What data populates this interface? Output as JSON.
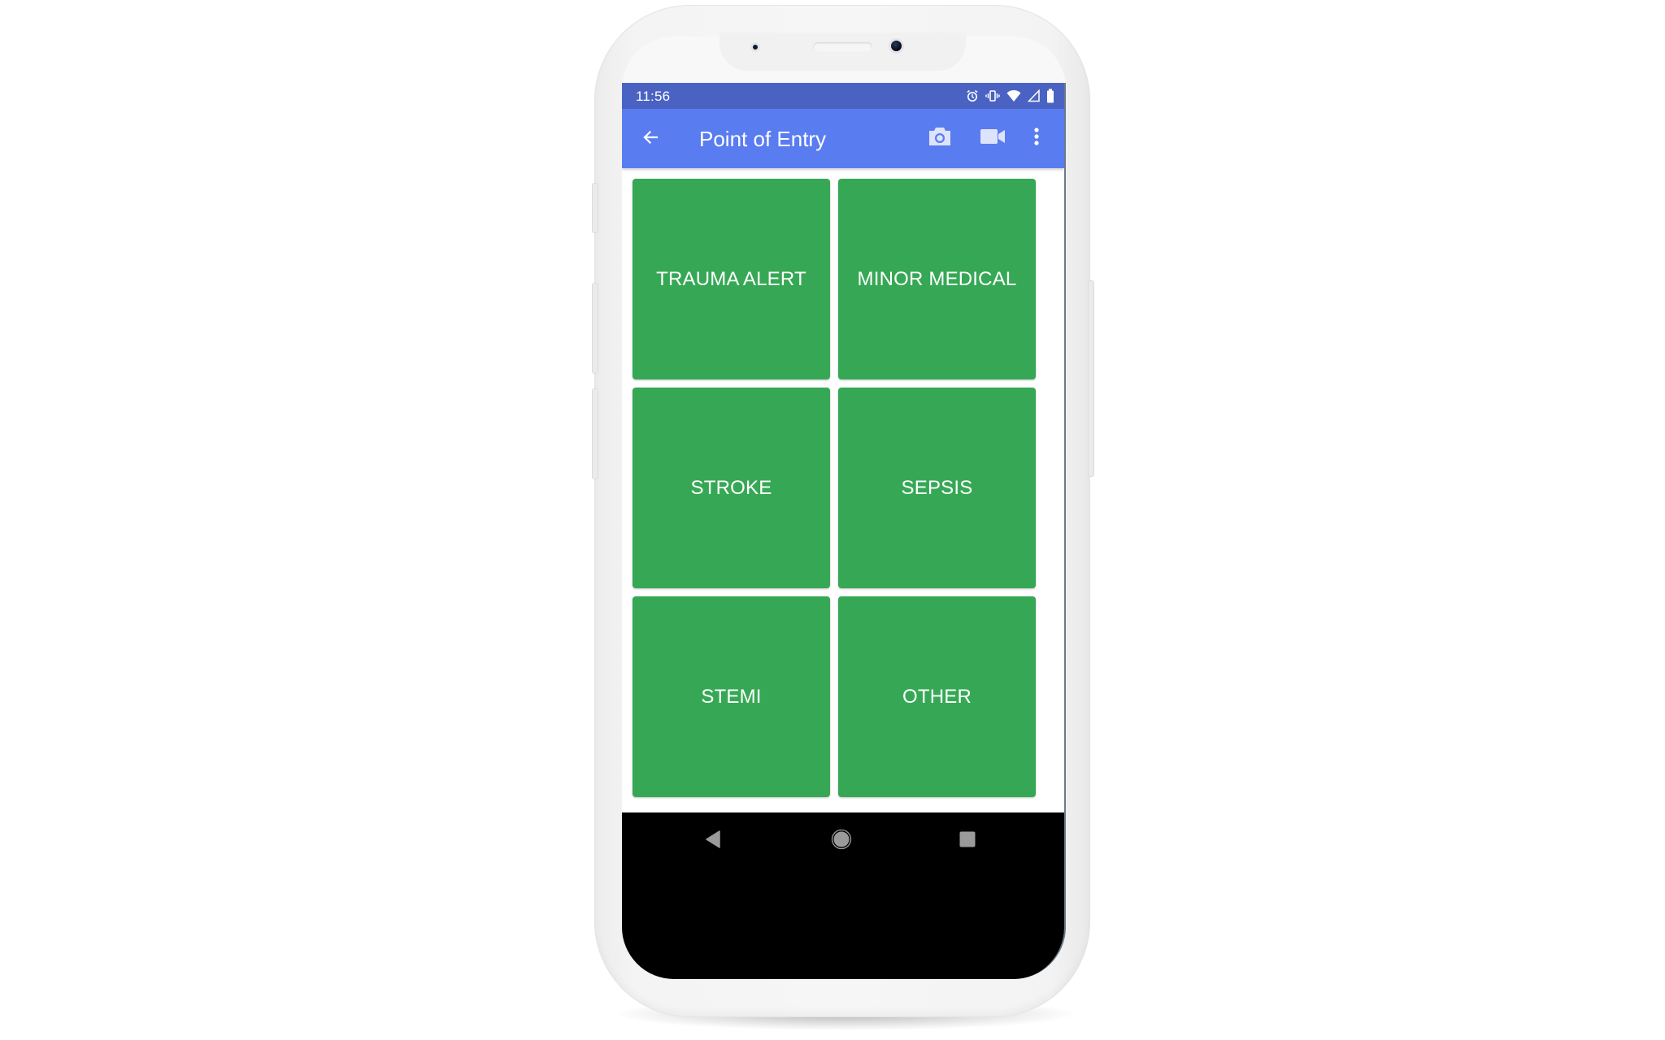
{
  "status_bar": {
    "time": "11:56",
    "icons": [
      "alarm-icon",
      "vibrate-icon",
      "wifi-icon",
      "cell-signal-icon",
      "battery-icon"
    ]
  },
  "app_bar": {
    "title": "Point of Entry",
    "back_icon": "arrow-back-icon",
    "actions": [
      {
        "name": "camera",
        "icon": "camera-icon"
      },
      {
        "name": "video",
        "icon": "video-camera-icon"
      },
      {
        "name": "more",
        "icon": "more-vert-icon"
      }
    ]
  },
  "tiles": [
    {
      "label": "TRAUMA ALERT"
    },
    {
      "label": "MINOR MEDICAL"
    },
    {
      "label": "STROKE"
    },
    {
      "label": "SEPSIS"
    },
    {
      "label": "STEMI"
    },
    {
      "label": "OTHER"
    }
  ],
  "nav_bar": {
    "buttons": [
      "back-triangle-icon",
      "home-circle-icon",
      "recents-square-icon"
    ]
  },
  "colors": {
    "status_bar": "#4a63c3",
    "app_bar": "#5a7cf1",
    "tile": "#36a855",
    "tile_text": "#ffffff",
    "nav_bar": "#000000",
    "nav_icon": "#9a9a9a"
  }
}
